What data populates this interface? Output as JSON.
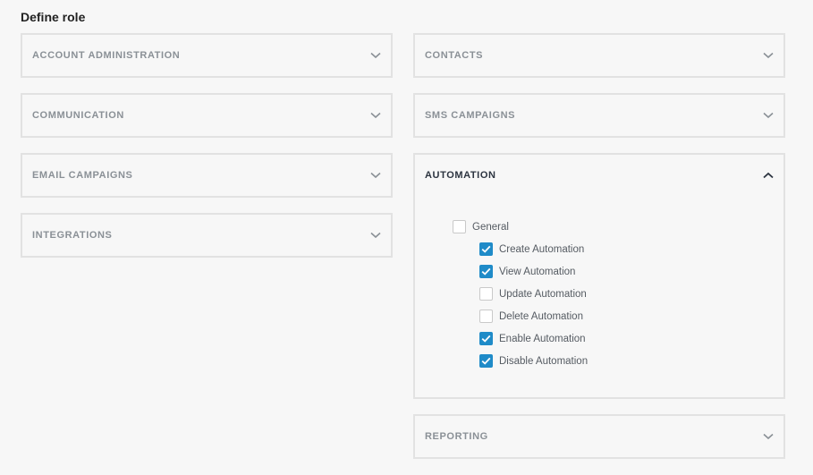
{
  "page": {
    "title": "Define role"
  },
  "left_panels": [
    {
      "label": "ACCOUNT ADMINISTRATION"
    },
    {
      "label": "COMMUNICATION"
    },
    {
      "label": "EMAIL CAMPAIGNS"
    },
    {
      "label": "INTEGRATIONS"
    }
  ],
  "right_panels": {
    "contacts": {
      "label": "CONTACTS"
    },
    "sms": {
      "label": "SMS CAMPAIGNS"
    },
    "automation": {
      "label": "AUTOMATION",
      "expanded": true,
      "general": {
        "label": "General",
        "checked": false
      },
      "permissions": [
        {
          "label": "Create Automation",
          "checked": true
        },
        {
          "label": "View Automation",
          "checked": true
        },
        {
          "label": "Update Automation",
          "checked": false
        },
        {
          "label": "Delete Automation",
          "checked": false
        },
        {
          "label": "Enable Automation",
          "checked": true
        },
        {
          "label": "Disable Automation",
          "checked": true
        }
      ]
    },
    "reporting": {
      "label": "REPORTING"
    }
  },
  "colors": {
    "accent": "#1f8bc8",
    "border": "#e2e2e2",
    "muted_label": "#8a9096",
    "active_label": "#2c3440"
  },
  "icons": {
    "collapsed": "chevron-down-icon",
    "expanded": "chevron-up-icon",
    "checked": "checkmark-icon"
  }
}
